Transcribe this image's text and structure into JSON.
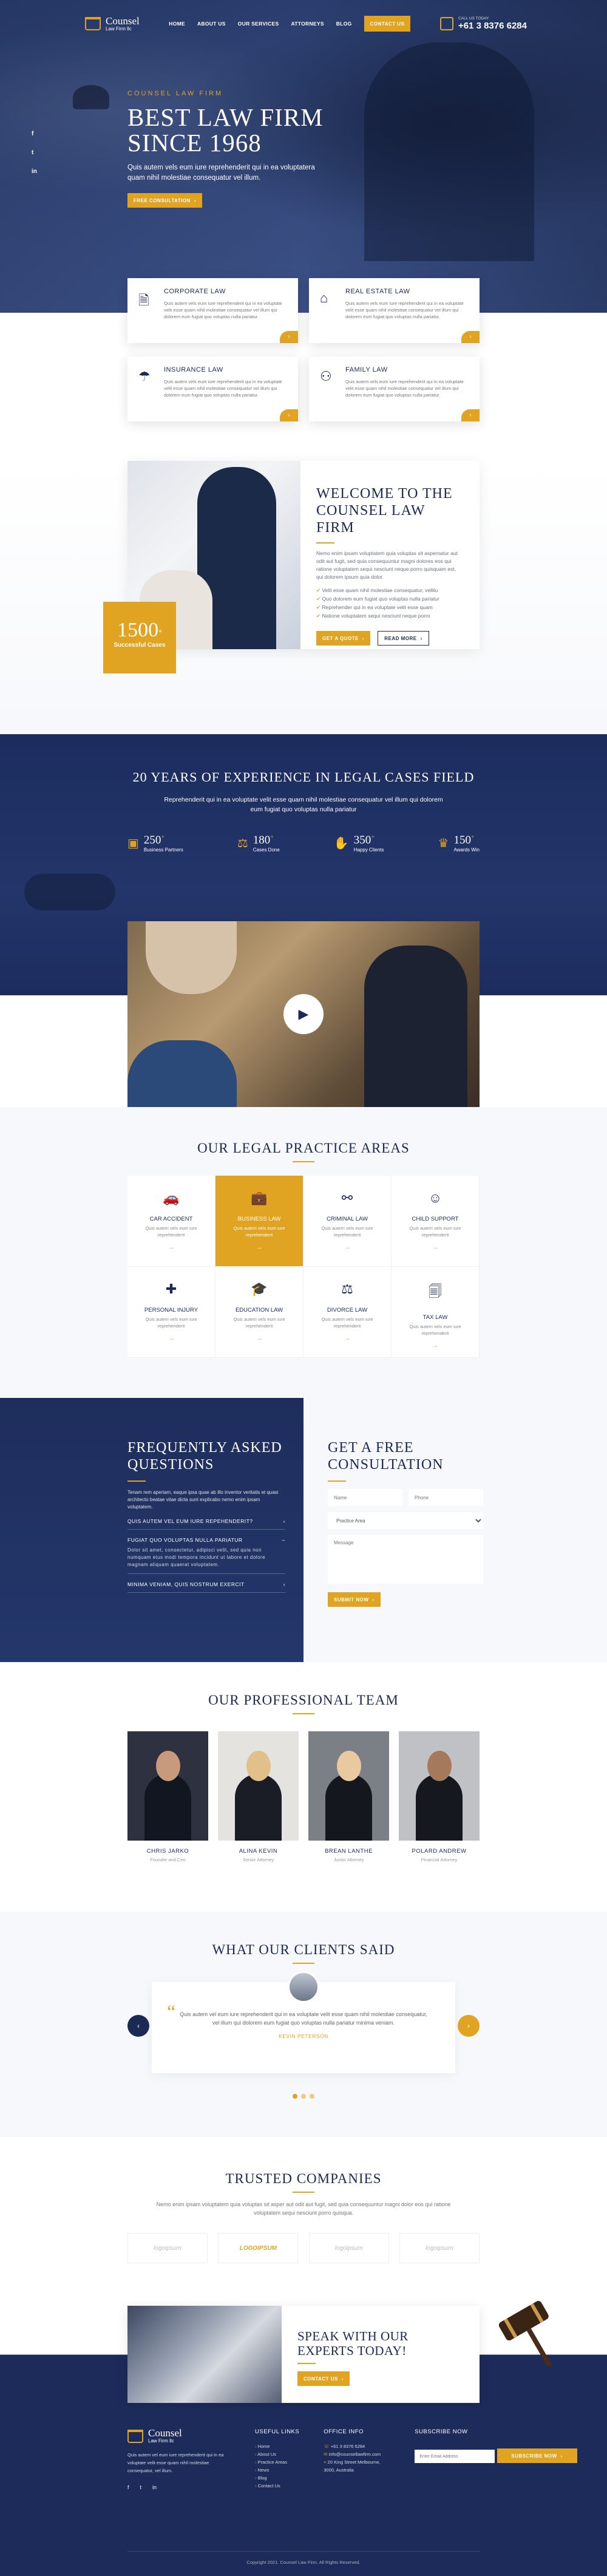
{
  "brand": {
    "name": "Counsel",
    "sub": "Law Firm llc"
  },
  "nav": {
    "items": [
      "HOME",
      "ABOUT US",
      "OUR SERVICES",
      "ATTORNEYS",
      "BLOG"
    ],
    "contact_btn": "CONTACT US",
    "call_label": "CALL US TODAY",
    "phone": "+61 3 8376 6284"
  },
  "hero": {
    "kicker": "COUNSEL LAW FIRM",
    "title_1": "BEST LAW FIRM",
    "title_2": "SINCE 1968",
    "desc": "Quis autem vels eum iure reprehenderit qui in ea voluptatera quam nihil molestiae consequatur vel illum.",
    "button": "FREE CONSULTATION",
    "social": [
      "f",
      "t",
      "in"
    ]
  },
  "services": [
    {
      "title": "CORPORATE LAW",
      "desc": "Quis autem vels eum iure reprehenderit qui in ea voluptate velit esse quam nihil molestiae consequatur vel illum qui dolorem eum fugiat quo voluptas nulla pariatur.",
      "icon": "document-icon"
    },
    {
      "title": "REAL ESTATE LAW",
      "desc": "Quis autem vels eum iure reprehenderit qui in ea voluptate velit esse quam nihil molestiae consequatur vel illum qui dolorem eum fugiat quo voluptas nulla pariatur.",
      "icon": "house-icon"
    },
    {
      "title": "INSURANCE LAW",
      "desc": "Quis autem vels eum iure reprehenderit qui in ea voluptate velit esse quam nihil molestiae consequatur vel illum qui dolorem eum fugiat quo voluptas nulla pariatur.",
      "icon": "umbrella-icon"
    },
    {
      "title": "FAMILY LAW",
      "desc": "Quis autem vels eum iure reprehenderit qui in ea voluptate velit esse quam nihil molestiae consequatur vel illum qui dolorem eum fugiat quo voluptas nulla pariatur.",
      "icon": "family-icon"
    }
  ],
  "welcome": {
    "title_1": "WELCOME TO THE",
    "title_2": "COUNSEL LAW FIRM",
    "desc": "Nemo enim ipsam voluptatem quia voluptas sit aspernatur aut odit aut fugit, sed quia consequuntur magni dolores eos qui ratione voluptatem sequi nesciunt neque porro quisquam est, qui dolorem ipsum quia dolor.",
    "points": [
      "Velit esse quam nihil molestiae consequatur, vellilu",
      "Quo dolorem eum fugiat quo voluptas nulla pariatur",
      "Reprehender qui in ea voluptate velit esse quam",
      "Natione voluptatem sequi nesciunt neque porro"
    ],
    "btn_quote": "GET A QUOTE",
    "btn_more": "READ MORE",
    "badge_num": "1500",
    "badge_plus": "+",
    "badge_label": "Successful Cases"
  },
  "experience": {
    "title": "20 YEARS OF EXPERIENCE IN LEGAL CASES FIELD",
    "desc": "Reprehenderit qui in ea voluptate velit esse quam nihil molestiae consequatur vel illum qui dolorem eum fugiat quo voluptas nulla pariatur",
    "stats": [
      {
        "num": "250",
        "label": "Business Partners"
      },
      {
        "num": "180",
        "label": "Cases Done"
      },
      {
        "num": "350",
        "label": "Happy Clients"
      },
      {
        "num": "150",
        "label": "Awards Win"
      }
    ]
  },
  "practice": {
    "title": "OUR LEGAL PRACTICE AREAS",
    "desc": "Quis autem vels eum iure reprehenderit",
    "items": [
      {
        "title": "CAR ACCIDENT",
        "icon": "car-icon"
      },
      {
        "title": "BUSINESS LAW",
        "icon": "briefcase-icon"
      },
      {
        "title": "CRIMINAL LAW",
        "icon": "handcuffs-icon"
      },
      {
        "title": "CHILD SUPPORT",
        "icon": "child-icon"
      },
      {
        "title": "PERSONAL INJURY",
        "icon": "injury-icon"
      },
      {
        "title": "EDUCATION LAW",
        "icon": "education-icon"
      },
      {
        "title": "DIVORCE LAW",
        "icon": "divorce-icon"
      },
      {
        "title": "TAX LAW",
        "icon": "tax-icon"
      }
    ]
  },
  "faq": {
    "title_1": "FREQUENTLY ASKED",
    "title_2": "QUESTIONS",
    "desc": "Tenam rem aperiam, eaque ipsa quae ab illo inventor veritatis et quasi architecto beatae vitae dicta sunt explicabo nemo enim ipsam voluptatem.",
    "items": [
      "QUIS AUTEM VEL EUM IURE REPEHENDERIT?",
      "FUGIAT QUO VOLUPTAS NULLA PARIATUR",
      "MINIMA VENIAM, QUIS NOSTRUM EXERCIT"
    ],
    "answer": "Dolor sit amet, consectetur, adipisci velit, sed quia non numquam eius modi tempora incidunt ut labore et dolore magnam aliquam quaerat voluptatem."
  },
  "consult": {
    "title_1": "GET A FREE",
    "title_2": "CONSULTATION",
    "name": "Name",
    "phone": "Phone",
    "area": "Practice Area",
    "message": "Message",
    "submit": "SUBMIT NOW"
  },
  "team": {
    "title": "OUR PROFESSIONAL TEAM",
    "members": [
      {
        "name": "CHRIS JARKO",
        "role": "Founder and Ceo"
      },
      {
        "name": "ALINA KEVIN",
        "role": "Senior Attorney"
      },
      {
        "name": "BREAN LANTHE",
        "role": "Junior Attorney"
      },
      {
        "name": "POLARD ANDREW",
        "role": "Financial Attorney"
      }
    ]
  },
  "clients": {
    "title": "WHAT OUR CLIENTS SAID",
    "quote": "Quis autem vel eum iure reprehenderit qui in ea voluptate velit esse quam nihil molestiae consequatur, vel illum qui dolorem eum fugiat quo voluptas nulla pariatur minima veniam.",
    "name": "KEVIN PETERSON"
  },
  "trusted": {
    "title": "TRUSTED COMPANIES",
    "desc": "Nemo enim ipsam voluptatem quia voluptas sit asper aut odit aut fugit, sed quia consequuntur magni dolor eos qui ratione voluptatem sequi nesciunt porro quisqua.",
    "logos": [
      "logoipsum",
      "LOGOIPSUM",
      "logoipsum",
      "logoipsum"
    ]
  },
  "cta": {
    "title_1": "SPEAK WITH OUR",
    "title_2": "EXPERTS TODAY!",
    "button": "CONTACT US"
  },
  "footer": {
    "about": "Quis autem vel eum iure reprehenderit qui in ea voluptate velit esse quam nihil molestiae consequatur, vel illum.",
    "links_title": "USEFUL LINKS",
    "links": [
      "Home",
      "About Us",
      "Practice Areas",
      "News",
      "Blog",
      "Contact Us"
    ],
    "office_title": "OFFICE INFO",
    "office": [
      "+61 3 8376 6284",
      "info@counsellawfirm.com",
      "20 King Street Melbourne, 3000, Australia"
    ],
    "news_title": "SUBSCRIBE NOW",
    "email": "Enter Email Address",
    "subscribe": "SUBSCRIBE NOW",
    "copyright": "Copyright 2021. Counsel Law Firm. All Rights Reserved."
  },
  "colors": {
    "navy": "#1b2a55",
    "gold": "#e0a322"
  }
}
